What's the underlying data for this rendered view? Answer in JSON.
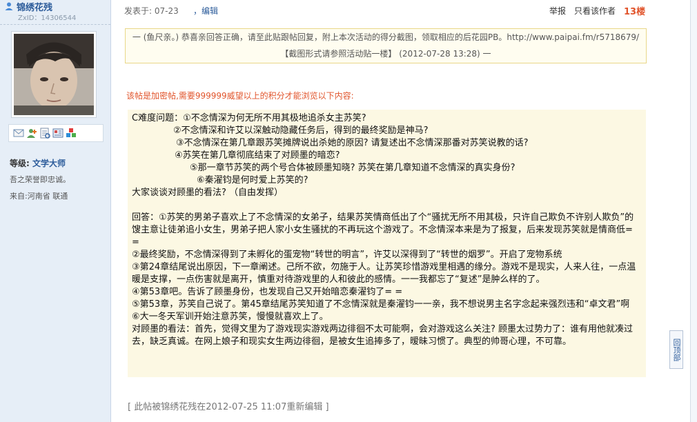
{
  "user": {
    "name": "锦绣花残",
    "id_label": "ZxID：14306544",
    "rank_label": "等级:",
    "rank_value": "文学大师",
    "signature": "吾之荣誉即忠诚。",
    "location": "来自:河南省  联通"
  },
  "post_header": {
    "date": "发表于: 07-23",
    "edit": "，编辑",
    "report": "举报",
    "only_author": "只看该作者",
    "floor": "13楼"
  },
  "notice": {
    "text": "一 (鱼尺亲。) 恭喜亲回答正确，请至此贴跟帖回复，附上本次活动的得分截图，领取相应的后花园PB。http://www.paipai.fm/r5718679/ 【截图形式请参照活动贴一楼】 (2012-07-28 13:28) 一"
  },
  "encrypt_note": "该帖是加密帖,需要999999威望以上的积分才能浏览以下内容:",
  "content": {
    "q0": "C难度问题：①不念情深为何无所不用其极地追杀女主苏笑?",
    "q1": "②不念情深和许艾以深触动隐藏任务后，得到的最终奖励是神马?",
    "q2": "③不念情深在第几章跟苏笑摊牌说出杀她的原因? 请复述出不念情深那番对苏笑说教的话?",
    "q3": "④苏笑在第几章彻底结束了对顾墨的暗恋?",
    "q4": "⑤那一章节苏笑的两个号合体被顾墨知晓? 苏笑在第几章知道不念情深的真实身份?",
    "q5": "⑥秦濯钧是何时爱上苏笑的?",
    "q6": "大家谈谈对顾墨的看法? （自由发挥）",
    "a1": "回答：①苏笑的男弟子喜欢上了不念情深的女弟子，结果苏笑情商低出了个“骚扰无所不用其极，只许自己欺负不许别人欺负”的馊主意让徒弟追小女生，男弟子把人家小女生骚扰的不再玩这个游戏了。不念情深本来是为了报复，后来发现苏笑就是情商低= =",
    "a2": "②最终奖励，不念情深得到了未孵化的蛋宠物“转世的明言”，许艾以深得到了“转世的烟罗”。开启了宠物系统",
    "a3": "③第24章结尾说出原因，下一章阐述。己所不欲，勿施于人。让苏笑珍惜游戏里相遇的缘分。游戏不是现实，人来人往，一点温暖是支撑，一点伤害就是离开，慎重对待游戏里的人和彼此的感情。一一我都忘了“复述”是肿么样的了。",
    "a4": "④第53章吧。告诉了顾墨身份，也发现自己又开始暗恋秦濯钧了= =",
    "a5": "⑤第53章，苏笑自己说了。第45章结尾苏笑知道了不念情深就是秦濯钧一一亲，我不想说男主名字念起来强烈违和“卓文君”啊",
    "a6": "⑥大一冬天军训开始注意苏笑，慢慢就喜欢上了。",
    "a7": "对顾墨的看法：首先，觉得文里为了游戏现实游戏两边徘徊不太可能啊，会对游戏这么关注? 顾墨太过势力了：谁有用他就凑过去，缺乏真诚。在网上娘子和现实女生两边徘徊，是被女生追捧多了，暧昧习惯了。典型的帅哥心理，不可靠。"
  },
  "edited_note": "[ 此帖被锦绣花残在2012-07-25 11:07重新编辑 ]",
  "back_to_top": "回顶部"
}
